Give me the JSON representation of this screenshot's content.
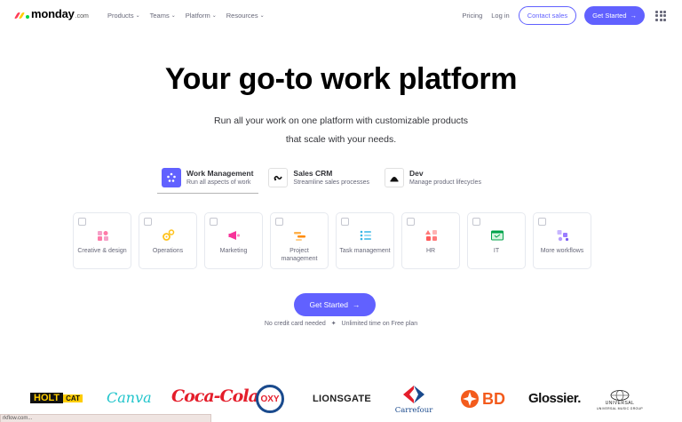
{
  "nav": {
    "logo_text": "monday",
    "logo_suffix": ".com",
    "links": [
      "Products",
      "Teams",
      "Platform",
      "Resources"
    ],
    "pricing": "Pricing",
    "login": "Log in",
    "contact_sales": "Contact sales",
    "get_started": "Get Started",
    "arrow": "→"
  },
  "hero": {
    "title": "Your go-to work platform",
    "subtitle": "Run all your work on one platform with customizable products that scale with your needs."
  },
  "products": [
    {
      "name": "Work Management",
      "desc": "Run all aspects of work",
      "active": true
    },
    {
      "name": "Sales CRM",
      "desc": "Streamline sales processes",
      "active": false
    },
    {
      "name": "Dev",
      "desc": "Manage product lifecycles",
      "active": false
    }
  ],
  "categories": [
    {
      "label": "Creative & design",
      "icon": "creative-icon"
    },
    {
      "label": "Operations",
      "icon": "operations-icon"
    },
    {
      "label": "Marketing",
      "icon": "megaphone-icon"
    },
    {
      "label": "Project management",
      "icon": "project-icon"
    },
    {
      "label": "Task management",
      "icon": "task-list-icon"
    },
    {
      "label": "HR",
      "icon": "hr-icon"
    },
    {
      "label": "IT",
      "icon": "it-icon"
    },
    {
      "label": "More workflows",
      "icon": "more-workflows-icon"
    }
  ],
  "cta": {
    "label": "Get Started",
    "arrow": "→",
    "note_1": "No credit card needed",
    "separator": "✦",
    "note_2": "Unlimited time on Free plan"
  },
  "logos": {
    "holt_a": "HOLT",
    "holt_b": "CAT",
    "canva": "Canva",
    "coke": "Coca-Cola",
    "oxy": "OXY",
    "lionsgate": "LIONSGATE",
    "carrefour": "Carrefour",
    "bd": "BD",
    "glossier": "Glossier.",
    "umg_top": "UNIVERSAL",
    "umg_bottom": "UNIVERSAL MUSIC GROUP"
  },
  "status_text": "rkflow.com...",
  "colors": {
    "primary": "#6161ff",
    "text": "#323338",
    "muted": "#676879"
  }
}
